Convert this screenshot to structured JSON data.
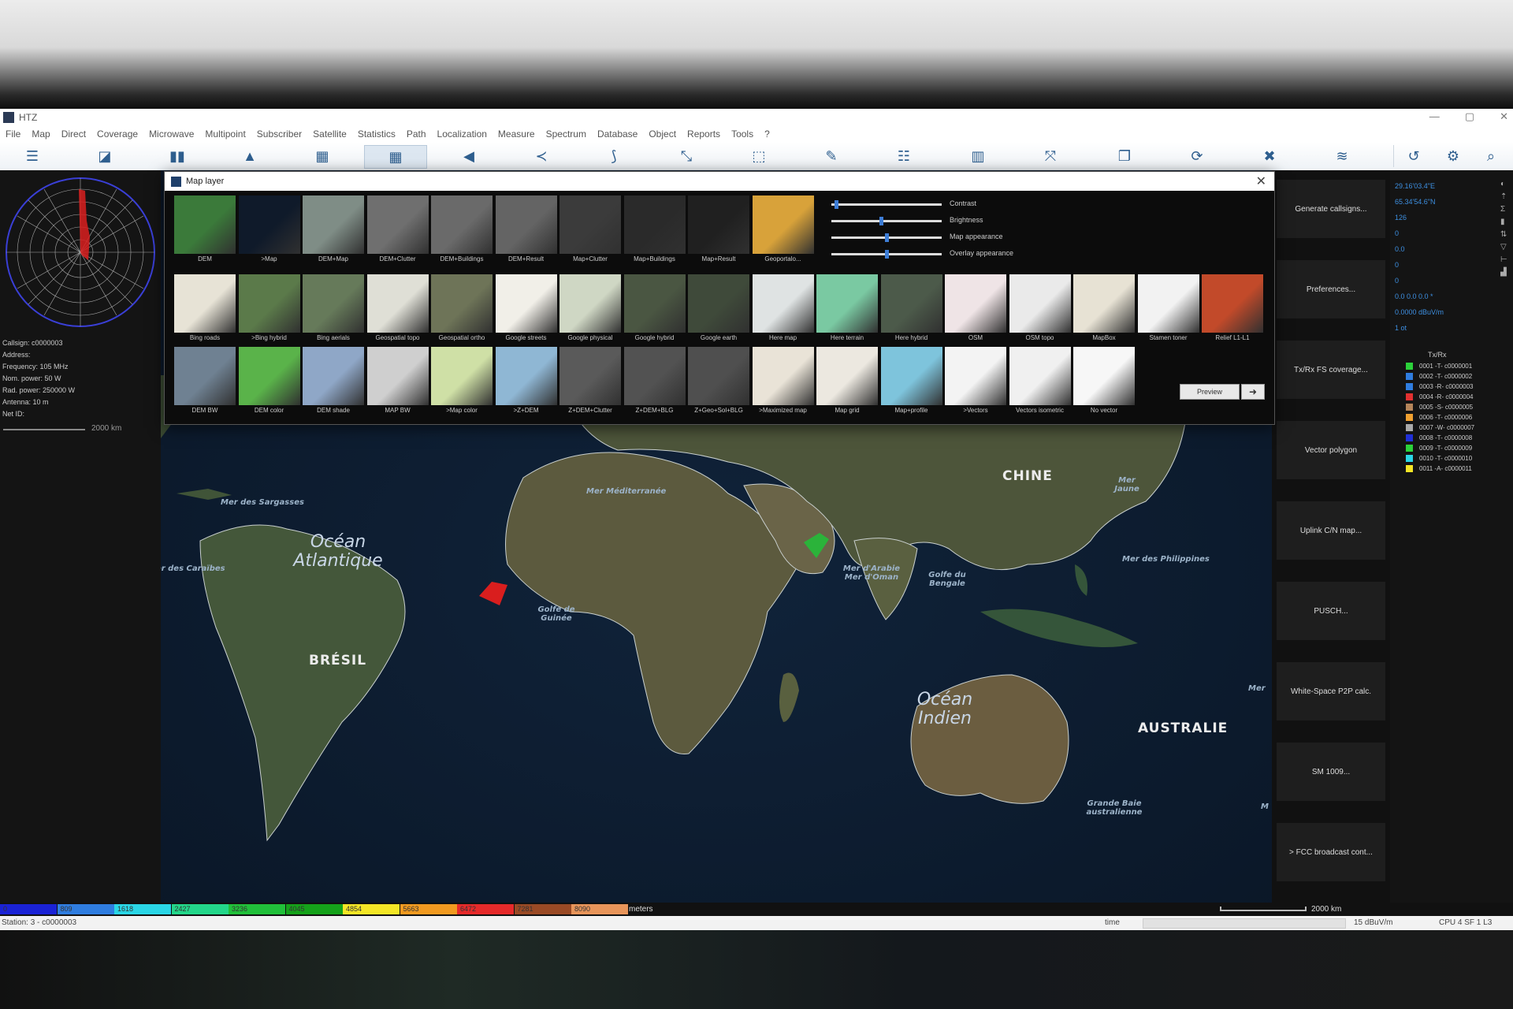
{
  "window": {
    "title": "HTZ",
    "controls": [
      "—",
      "▢",
      "✕"
    ]
  },
  "menu": [
    "File",
    "Map",
    "Direct",
    "Coverage",
    "Microwave",
    "Multipoint",
    "Subscriber",
    "Satellite",
    "Statistics",
    "Path",
    "Localization",
    "Measure",
    "Spectrum",
    "Database",
    "Object",
    "Reports",
    "Tools",
    "?"
  ],
  "toolbar_icons": [
    "list-icon",
    "window-icon",
    "bar-chart-icon",
    "mountain-icon",
    "grid-frame-icon",
    "grid-icon",
    "speaker-icon",
    "share-icon",
    "route-icon",
    "diagonal-icon",
    "select-icon",
    "pen-icon",
    "table-icon",
    "columns-icon",
    "expand-icon",
    "layers-window-icon",
    "refresh-icon",
    "close-x-icon",
    "stack-icon",
    "rotate-icon",
    "settings-icon",
    "zoom-icon"
  ],
  "left_panel": {
    "info": [
      "Callsign: c0000003",
      "Address:",
      "Frequency: 105 MHz",
      "Nom. power: 50 W",
      "Rad. power: 250000 W",
      "Antenna: 10 m",
      "Net ID:"
    ],
    "scale_label": "2000 km"
  },
  "dialog": {
    "title": "Map layer",
    "row1": [
      "DEM",
      ">Map",
      "DEM+Map",
      "DEM+Clutter",
      "DEM+Buildings",
      "DEM+Result",
      "Map+Clutter",
      "Map+Buildings",
      "Map+Result",
      "Geoportalo..."
    ],
    "row2": [
      "Bing roads",
      ">Bing hybrid",
      "Bing aerials",
      "Geospatial topo",
      "Geospatial ortho",
      "Google streets",
      "Google physical",
      "Google hybrid",
      "Google earth",
      "Here map",
      "Here terrain",
      "Here hybrid",
      "OSM",
      "OSM topo",
      "MapBox",
      "Stamen toner",
      "Relief L1-L1"
    ],
    "row3": [
      "DEM BW",
      "DEM color",
      "DEM shade",
      "MAP BW",
      ">Map color",
      ">Z+DEM",
      "Z+DEM+Clutter",
      "Z+DEM+BLG",
      "Z+Geo+Sol+BLG",
      ">Maximized map",
      "Map grid",
      "Map+profile",
      ">Vectors",
      "Vectors isometric",
      "No vector"
    ],
    "sliders": [
      {
        "label": "Contrast",
        "value": 0.03
      },
      {
        "label": "Brightness",
        "value": 0.45
      },
      {
        "label": "Map appearance",
        "value": 0.5
      },
      {
        "label": "Overlay appearance",
        "value": 0.5
      }
    ],
    "preview_label": "Preview",
    "arrow_label": "➜"
  },
  "side_buttons": [
    "Generate callsigns...",
    "Preferences...",
    "Tx/Rx FS coverage...",
    "Vector polygon",
    "Uplink C/N map...",
    "PUSCH...",
    "White-Space P2P calc.",
    "SM 1009...",
    "> FCC broadcast cont..."
  ],
  "right_panel": {
    "coords": [
      "29.16'03.4\"E",
      "65.34'54.6\"N",
      "126",
      "0",
      "0.0",
      "0",
      "0",
      "0.0 0.0 0.0 *",
      "0.0000 dBuV/m",
      "1 ot"
    ],
    "txrx_title": "Tx/Rx",
    "txrx": [
      {
        "label": "0001 -T- c0000001",
        "color": "#2bd23a"
      },
      {
        "label": "0002 -T- c0000002",
        "color": "#2f7de0"
      },
      {
        "label": "0003 -R- c0000003",
        "color": "#2f7de0"
      },
      {
        "label": "0004 -R- c0000004",
        "color": "#e23030"
      },
      {
        "label": "0005 -S- c0000005",
        "color": "#b5855a"
      },
      {
        "label": "0006 -T- c0000006",
        "color": "#f0a030"
      },
      {
        "label": "0007 -W- c0000007",
        "color": "#aaaaaa"
      },
      {
        "label": "0008 -T- c0000008",
        "color": "#2030d8"
      },
      {
        "label": "0009 -T- c0000009",
        "color": "#2bd23a"
      },
      {
        "label": "0010 -T- c0000010",
        "color": "#2ad6e6"
      },
      {
        "label": "0011 -A- c0000011",
        "color": "#f4e626"
      }
    ]
  },
  "map_labels": {
    "ocean_atlantic": "Océan Atlantique",
    "ocean_indian": "Océan Indien",
    "sargasso": "Mer des Sargasses",
    "caribbean": "Mer des Caraïbes",
    "mediterranean": "Mer Méditerranée",
    "arabia": "Mer d'Arabie Mer d'Oman",
    "bengal": "Golfe du Bengale",
    "guinea": "Golfe de Guinée",
    "philippines": "Mer des Philippines",
    "yellow_sea": "Mer Jaune",
    "grande_baie": "Grande Baie australienne",
    "brazil": "BRÉSIL",
    "china": "CHINE",
    "australia": "AUSTRALIE",
    "mer": "Mer",
    "m": "M"
  },
  "legend": {
    "cells": [
      {
        "label": "0",
        "color": "#1a22d6"
      },
      {
        "label": "809",
        "color": "#2f7de0"
      },
      {
        "label": "1618",
        "color": "#2ad6e6"
      },
      {
        "label": "2427",
        "color": "#23d78a"
      },
      {
        "label": "3236",
        "color": "#21c03a"
      },
      {
        "label": "4045",
        "color": "#15a21a"
      },
      {
        "label": "4854",
        "color": "#f4e626"
      },
      {
        "label": "5663",
        "color": "#f19a20"
      },
      {
        "label": "6472",
        "color": "#e62a2a"
      },
      {
        "label": "7281",
        "color": "#9a4a25"
      },
      {
        "label": "8090",
        "color": "#e8955a"
      }
    ],
    "unit": "meters",
    "scale_label": "2000 km"
  },
  "status": {
    "station": "Station: 3 - c0000003",
    "time": "time",
    "field": "15 dBuV/m",
    "cpu": "CPU 4  SF 1  L3"
  }
}
